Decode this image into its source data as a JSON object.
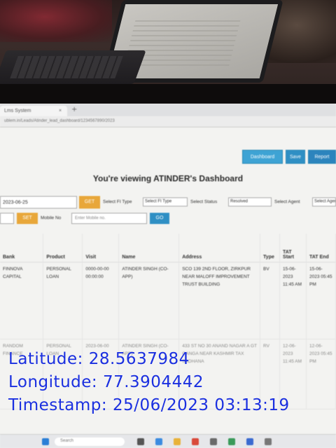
{
  "browser": {
    "tab_title": "Lms System",
    "tab_close": "×",
    "new_tab": "+",
    "url": "ublem.in/Leads/Atinder_lead_dashboard/1234567890/2023"
  },
  "header_buttons": [
    "Dashboard",
    "Save",
    "Report"
  ],
  "dashboard_title": "You're viewing ATINDER's Dashboard",
  "filters": {
    "date_value": "2023-06-25",
    "get_label": "GET",
    "fi_type_label": "Select FI Type",
    "fi_type_value": "Select FI Type",
    "status_label": "Select Status",
    "status_value": "Resolved",
    "agent_label": "Select Agent",
    "agent_value": "Select Agent",
    "set_label": "SET",
    "mobile_label": "Mobile No",
    "mobile_placeholder": "Enter Mobile no.",
    "go_label": "GO"
  },
  "table": {
    "columns": [
      "Bank",
      "Product",
      "Visit",
      "Name",
      "Address",
      "Type",
      "TAT Start",
      "TAT End"
    ],
    "rows": [
      [
        "FINNOVA CAPITAL",
        "PERSONAL LOAN",
        "0000-00-00 00:00:00",
        "ATINDER SINGH (CO-APP)",
        "SCO 139 2ND FLOOR, ZIRKPUR NEAR MALOFF IMPROVEMENT TRUST BUILDING",
        "BV",
        "15-06-2023 11:45 AM",
        "15-06-2023 05:45 PM"
      ],
      [
        "RANDOM FINANCE",
        "PERSONAL LOAN",
        "2023-06-00",
        "ATINDER SINGH (CO-APP)",
        "433 ST NO 30 ANAND NAGAR A GT GANGA NEAR KASHMIR TAX SADHANA",
        "RV",
        "12-06-2023 11:45 AM",
        "12-06-2023 05:45 PM"
      ]
    ]
  },
  "taskbar": {
    "search_placeholder": "Search"
  },
  "stamp": {
    "latitude": "Latitude: 28.5637984",
    "longitude": "Longitude: 77.3904442",
    "timestamp": "Timestamp: 25/06/2023 03:13:19"
  }
}
